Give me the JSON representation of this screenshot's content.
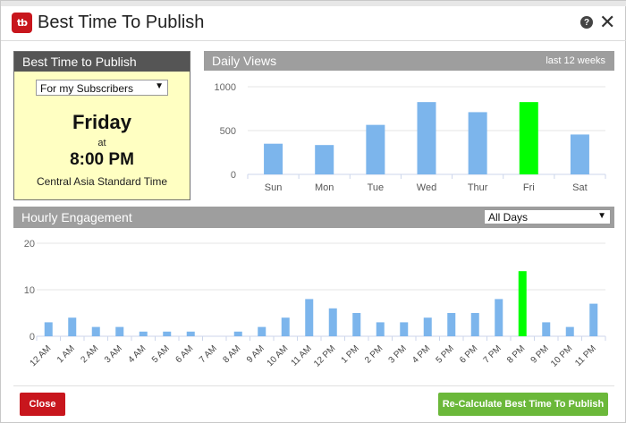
{
  "header": {
    "logo_text": "tb",
    "title": "Best Time To Publish",
    "help_glyph": "?",
    "close_glyph": "✕"
  },
  "best_time": {
    "panel_title": "Best Time to Publish",
    "audience_select": "For my Subscribers",
    "day": "Friday",
    "at_label": "at",
    "time": "8:00 PM",
    "timezone": "Central Asia Standard Time"
  },
  "daily_views": {
    "panel_title": "Daily Views",
    "range_label": "last 12 weeks"
  },
  "hourly": {
    "panel_title": "Hourly Engagement",
    "days_select": "All Days"
  },
  "colors": {
    "bar": "#7cb5ec",
    "highlight": "#00ff00",
    "brand_red": "#c8161d",
    "button_green": "#6bb83a"
  },
  "chart_data": [
    {
      "type": "bar",
      "categories": [
        "Sun",
        "Mon",
        "Tue",
        "Wed",
        "Thur",
        "Fri",
        "Sat"
      ],
      "values": [
        350,
        335,
        565,
        825,
        710,
        825,
        455
      ],
      "highlight_index": 5,
      "yticks": [
        "0",
        "500",
        "1000"
      ],
      "ylim": [
        0,
        1000
      ],
      "grid": true
    },
    {
      "type": "bar",
      "categories": [
        "12 AM",
        "1 AM",
        "2 AM",
        "3 AM",
        "4 AM",
        "5 AM",
        "6 AM",
        "7 AM",
        "8 AM",
        "9 AM",
        "10 AM",
        "11 AM",
        "12 PM",
        "1 PM",
        "2 PM",
        "3 PM",
        "4 PM",
        "5 PM",
        "6 PM",
        "7 PM",
        "8 PM",
        "9 PM",
        "10 PM",
        "11 PM"
      ],
      "values": [
        3,
        4,
        2,
        2,
        1,
        1,
        1,
        0,
        1,
        2,
        4,
        8,
        6,
        5,
        3,
        3,
        4,
        5,
        5,
        8,
        14,
        3,
        2,
        7
      ],
      "highlight_index": 20,
      "yticks": [
        "0",
        "10",
        "20"
      ],
      "ylim": [
        0,
        20
      ],
      "grid": true
    }
  ],
  "footer": {
    "close_label": "Close",
    "recalc_label": "Re-Calculate Best Time To Publish"
  }
}
